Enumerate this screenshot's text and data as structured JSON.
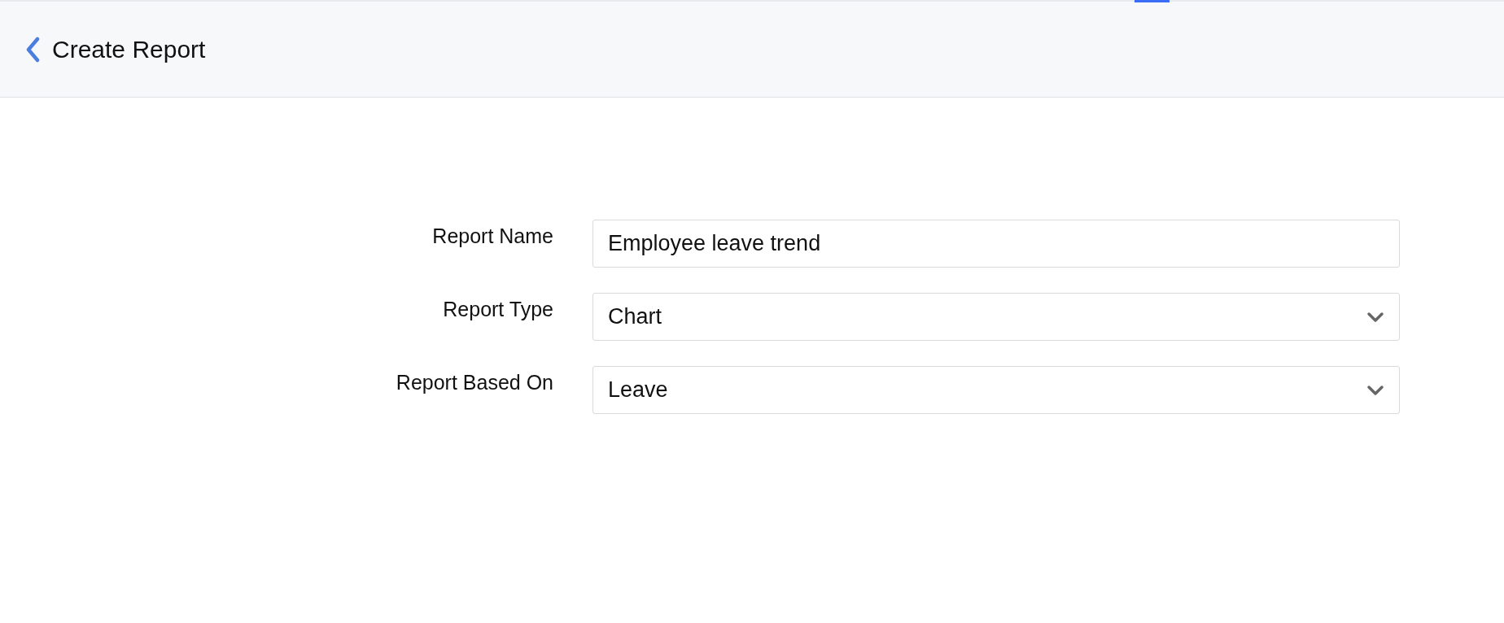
{
  "header": {
    "title": "Create Report"
  },
  "form": {
    "fields": [
      {
        "label": "Report Name",
        "kind": "text",
        "value": "Employee leave trend"
      },
      {
        "label": "Report Type",
        "kind": "select",
        "value": "Chart"
      },
      {
        "label": "Report Based On",
        "kind": "select",
        "value": "Leave"
      }
    ]
  }
}
